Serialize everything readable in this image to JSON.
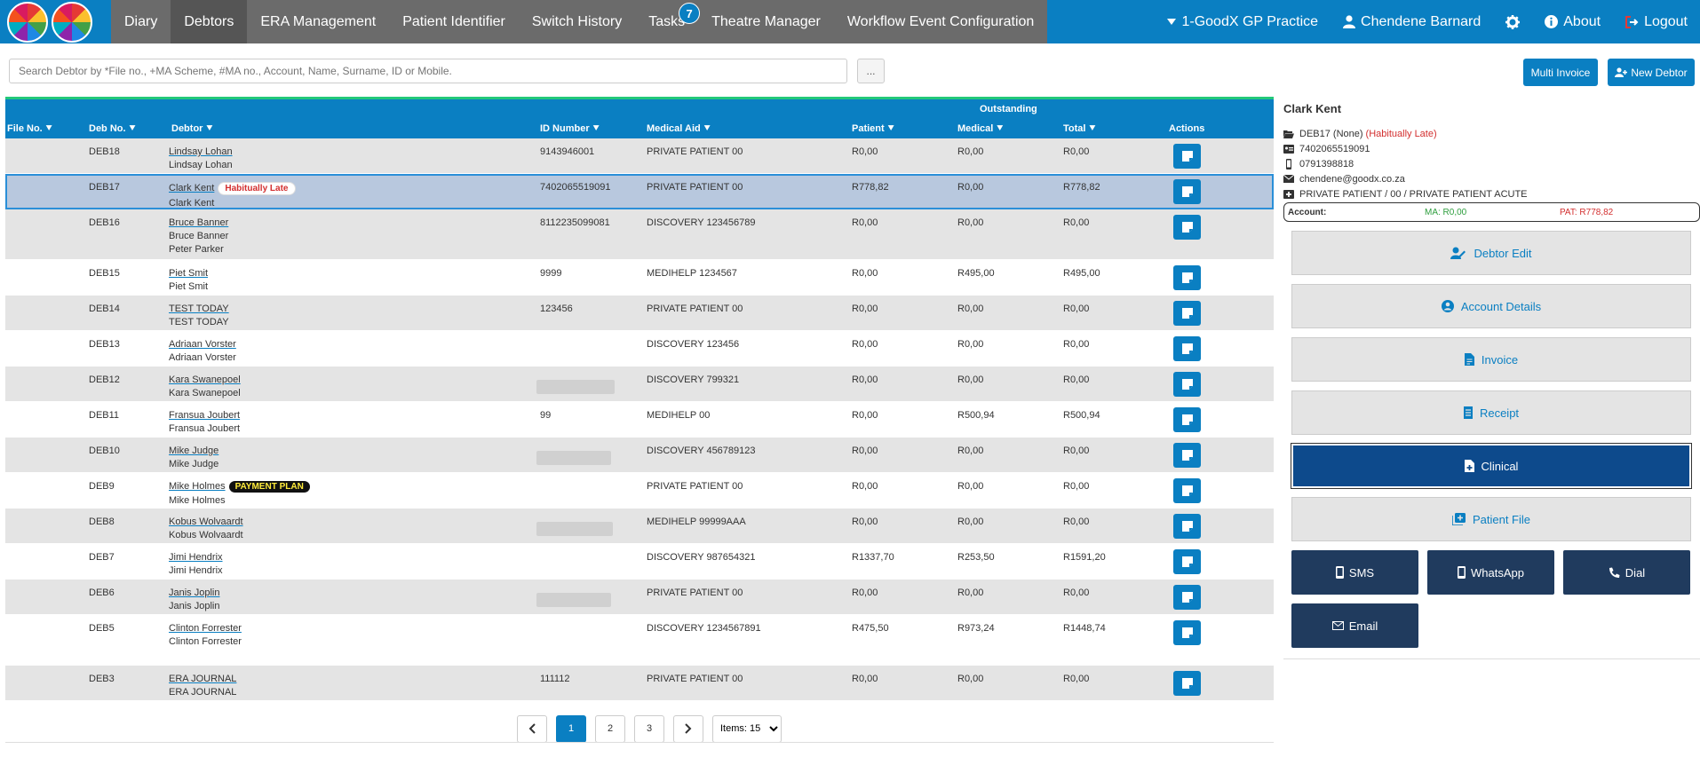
{
  "nav": {
    "items": [
      {
        "label": "Diary"
      },
      {
        "label": "Debtors"
      },
      {
        "label": "ERA Management"
      },
      {
        "label": "Patient Identifier"
      },
      {
        "label": "Switch History"
      },
      {
        "label": "Tasks",
        "badge": "7"
      },
      {
        "label": "Theatre Manager"
      },
      {
        "label": "Workflow Event Configuration"
      }
    ],
    "practice": "1-GoodX GP Practice",
    "user": "Chendene Barnard",
    "about": "About",
    "logout": "Logout"
  },
  "search": {
    "placeholder": "Search Debtor by *File no., +MA Scheme, #MA no., Account, Name, Surname, ID or Mobile.",
    "more_label": "...",
    "multi_invoice": "Multi Invoice",
    "new_debtor": "New Debtor"
  },
  "table": {
    "group_header": "Outstanding",
    "columns": {
      "file_no": "File No.",
      "deb_no": "Deb No.",
      "debtor": "Debtor",
      "id_number": "ID Number",
      "medical_aid": "Medical Aid",
      "patient": "Patient",
      "medical": "Medical",
      "total": "Total",
      "actions": "Actions"
    },
    "rows": [
      {
        "deb": "DEB18",
        "name": "Lindsay Lohan",
        "subs": [
          "Lindsay Lohan"
        ],
        "id": "9143946001",
        "ma": "PRIVATE PATIENT 00",
        "patient": "R0,00",
        "medical": "R0,00",
        "total": "R0,00"
      },
      {
        "deb": "DEB17",
        "name": "Clark Kent",
        "tag": "Habitually Late",
        "subs": [
          "Clark Kent"
        ],
        "id": "7402065519091",
        "ma": "PRIVATE PATIENT 00",
        "patient": "R778,82",
        "medical": "R0,00",
        "total": "R778,82"
      },
      {
        "deb": "DEB16",
        "name": "Bruce Banner",
        "subs": [
          "Bruce Banner",
          "Peter Parker"
        ],
        "id": "8112235099081",
        "ma": "DISCOVERY 123456789",
        "patient": "R0,00",
        "medical": "R0,00",
        "total": "R0,00"
      },
      {
        "deb": "DEB15",
        "name": "Piet Smit",
        "subs": [
          "Piet Smit"
        ],
        "id": "9999",
        "ma": "MEDIHELP 1234567",
        "patient": "R0,00",
        "medical": "R495,00",
        "total": "R495,00"
      },
      {
        "deb": "DEB14",
        "name": "TEST TODAY",
        "subs": [
          "TEST TODAY"
        ],
        "id": "123456",
        "ma": "PRIVATE PATIENT 00",
        "patient": "R0,00",
        "medical": "R0,00",
        "total": "R0,00"
      },
      {
        "deb": "DEB13",
        "name": "Adriaan Vorster",
        "subs": [
          "Adriaan Vorster"
        ],
        "id": "",
        "ma": "DISCOVERY 123456",
        "patient": "R0,00",
        "medical": "R0,00",
        "total": "R0,00"
      },
      {
        "deb": "DEB12",
        "name": "Kara Swanepoel",
        "subs": [
          "Kara Swanepoel"
        ],
        "id": "",
        "blur": true,
        "ma": "DISCOVERY 799321",
        "patient": "R0,00",
        "medical": "R0,00",
        "total": "R0,00"
      },
      {
        "deb": "DEB11",
        "name": "Fransua Joubert",
        "subs": [
          "Fransua Joubert"
        ],
        "id": "99",
        "ma": "MEDIHELP 00",
        "patient": "R0,00",
        "medical": "R500,94",
        "total": "R500,94"
      },
      {
        "deb": "DEB10",
        "name": "Mike Judge",
        "subs": [
          "Mike Judge"
        ],
        "id": "",
        "blur": true,
        "ma": "DISCOVERY 456789123",
        "patient": "R0,00",
        "medical": "R0,00",
        "total": "R0,00"
      },
      {
        "deb": "DEB9",
        "name": "Mike Holmes",
        "tag": "PAYMENT PLAN",
        "subs": [
          "Mike Holmes"
        ],
        "id": "",
        "ma": "PRIVATE PATIENT 00",
        "patient": "R0,00",
        "medical": "R0,00",
        "total": "R0,00"
      },
      {
        "deb": "DEB8",
        "name": "Kobus Wolvaardt",
        "subs": [
          "Kobus Wolvaardt"
        ],
        "id": "",
        "blur": true,
        "ma": "MEDIHELP 99999AAA",
        "patient": "R0,00",
        "medical": "R0,00",
        "total": "R0,00"
      },
      {
        "deb": "DEB7",
        "name": "Jimi Hendrix",
        "subs": [
          "Jimi Hendrix"
        ],
        "id": "",
        "ma": "DISCOVERY 987654321",
        "patient": "R1337,70",
        "medical": "R253,50",
        "total": "R1591,20"
      },
      {
        "deb": "DEB6",
        "name": "Janis Joplin",
        "subs": [
          "Janis Joplin"
        ],
        "id": "",
        "blur": true,
        "ma": "PRIVATE PATIENT 00",
        "patient": "R0,00",
        "medical": "R0,00",
        "total": "R0,00"
      },
      {
        "deb": "DEB5",
        "name": "Clinton Forrester",
        "subs": [
          "Clinton Forrester"
        ],
        "id": "",
        "ma": "DISCOVERY 1234567891",
        "patient": "R475,50",
        "medical": "R973,24",
        "total": "R1448,74"
      },
      {
        "deb": "DEB3",
        "name": "ERA JOURNAL",
        "subs": [
          "ERA JOURNAL"
        ],
        "id": "111112",
        "ma": "PRIVATE PATIENT 00",
        "patient": "R0,00",
        "medical": "R0,00",
        "total": "R0,00"
      }
    ]
  },
  "pagination": {
    "pages": [
      "1",
      "2",
      "3"
    ],
    "current": "1",
    "items_label": "Items: 15"
  },
  "panel": {
    "title": "Clark Kent",
    "deb_line": "DEB17 (None)",
    "deb_flag": "(Habitually Late)",
    "id": "7402065519091",
    "phone": "0791398818",
    "email": "chendene@goodx.co.za",
    "scheme": "PRIVATE PATIENT / 00 / PRIVATE PATIENT ACUTE",
    "account_label": "Account:",
    "ma_balance": "MA: R0,00",
    "pat_balance": "PAT: R778,82",
    "actions": [
      "Debtor Edit",
      "Account Details",
      "Invoice",
      "Receipt",
      "Clinical",
      "Patient File"
    ],
    "contact": [
      "SMS",
      "WhatsApp",
      "Dial",
      "Email"
    ]
  },
  "colors": {
    "brand_blue": "#0a7fc2",
    "nav_grey": "#6b6b6b",
    "dark_navy": "#203b5e",
    "late_red": "#d32f2f",
    "ma_green": "#2e9e3e"
  }
}
